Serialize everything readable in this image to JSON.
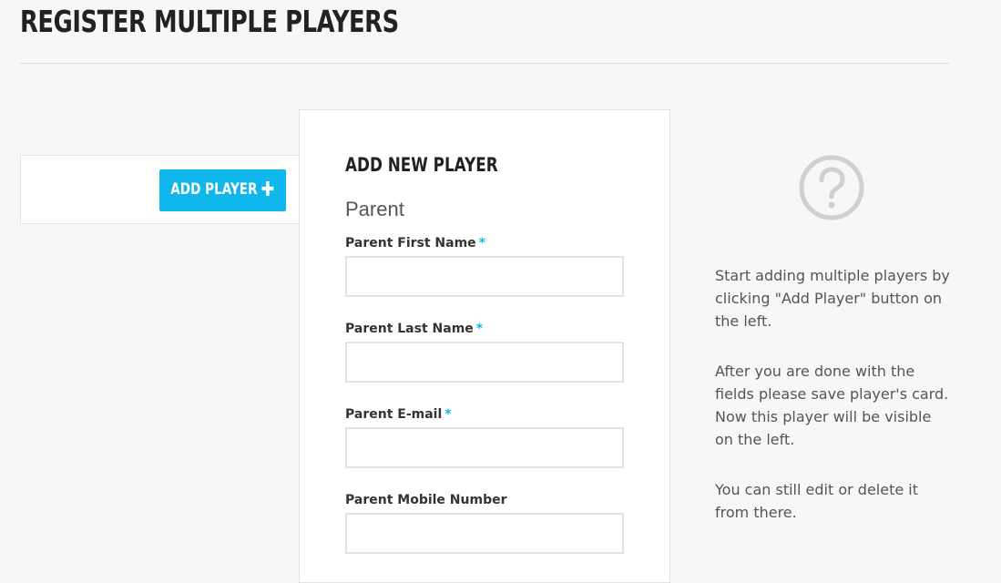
{
  "page": {
    "title": "REGISTER MULTIPLE PLAYERS"
  },
  "left_panel": {
    "add_player_label": "ADD PLAYER",
    "add_player_icon": "plus-icon"
  },
  "form": {
    "title": "ADD NEW PLAYER",
    "section_title": "Parent",
    "required_marker": "*",
    "fields": [
      {
        "label": "Parent First Name",
        "required": true,
        "value": "",
        "placeholder": ""
      },
      {
        "label": "Parent Last Name",
        "required": true,
        "value": "",
        "placeholder": ""
      },
      {
        "label": "Parent E-mail",
        "required": true,
        "value": "",
        "placeholder": ""
      },
      {
        "label": "Parent Mobile Number",
        "required": false,
        "value": "",
        "placeholder": ""
      }
    ]
  },
  "help": {
    "icon": "question-circle-icon",
    "paragraphs": [
      "Start adding multiple players by clicking \"Add Player\" button on the left.",
      "After you are done with the fields please save player's card. Now this player will be visible on the left.",
      "You can still edit or delete it from there."
    ]
  },
  "colors": {
    "accent": "#0fb7ec",
    "background": "#f7f7f7",
    "card": "#ffffff",
    "border": "#e3e3e3",
    "heading": "#222222",
    "body_text": "#555555",
    "help_icon": "#d0d0d0"
  }
}
